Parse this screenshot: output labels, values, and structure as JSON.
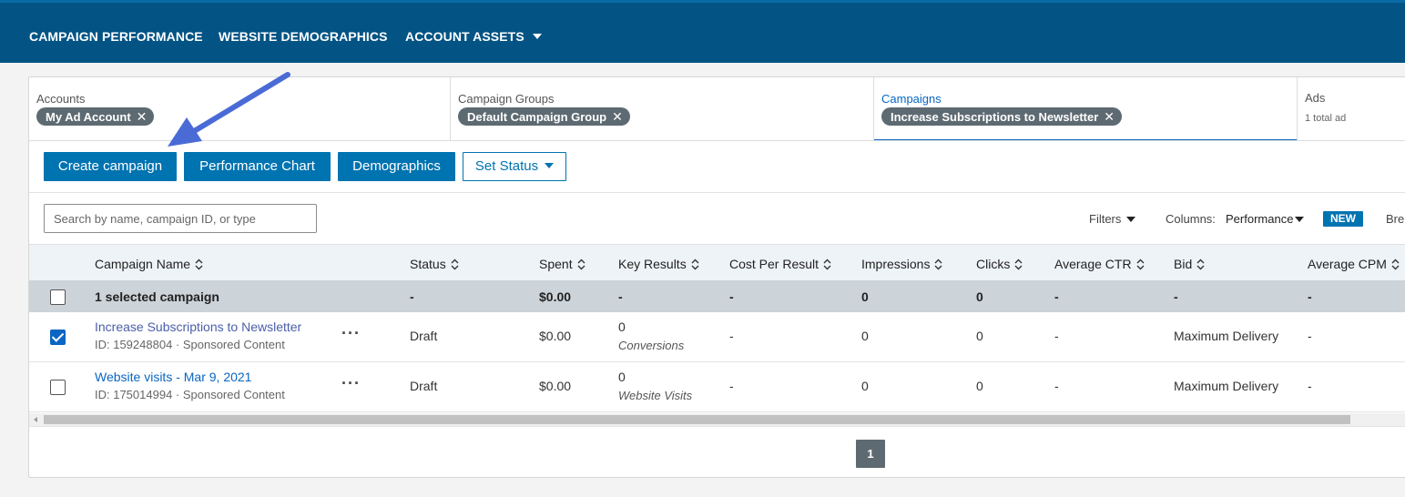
{
  "topnav": {
    "campaign_performance": "CAMPAIGN PERFORMANCE",
    "website_demographics": "WEBSITE DEMOGRAPHICS",
    "account_assets": "ACCOUNT ASSETS"
  },
  "breadcrumbs": {
    "accounts": {
      "title": "Accounts",
      "chip": "My Ad Account"
    },
    "campaign_groups": {
      "title": "Campaign Groups",
      "chip": "Default Campaign Group"
    },
    "campaigns": {
      "title": "Campaigns",
      "chip": "Increase Subscriptions to Newsletter"
    },
    "ads": {
      "title": "Ads",
      "sub": "1 total ad"
    }
  },
  "toolbar": {
    "create_campaign": "Create campaign",
    "performance_chart": "Performance Chart",
    "demographics": "Demographics",
    "set_status": "Set Status"
  },
  "search": {
    "placeholder": "Search by name, campaign ID, or type"
  },
  "controls": {
    "filters": "Filters",
    "columns_label": "Columns:",
    "columns_value": "Performance",
    "new_badge": "NEW",
    "breakdown_partial": "Bre"
  },
  "table": {
    "headers": [
      "Campaign Name",
      "Status",
      "Spent",
      "Key Results",
      "Cost Per Result",
      "Impressions",
      "Clicks",
      "Average CTR",
      "Bid",
      "Average CPM"
    ],
    "selected_row": {
      "label": "1 selected campaign",
      "status": "-",
      "spent": "$0.00",
      "key_results": "-",
      "cost_per_result": "-",
      "impressions": "0",
      "clicks": "0",
      "avg_ctr": "-",
      "bid": "-",
      "avg_cpm": "-"
    },
    "rows": [
      {
        "name": "Increase Subscriptions to Newsletter",
        "sub": "ID: 159248804 · Sponsored Content",
        "status": "Draft",
        "spent": "$0.00",
        "key_results_value": "0",
        "key_results_type": "Conversions",
        "cost_per_result": "-",
        "impressions": "0",
        "clicks": "0",
        "avg_ctr": "-",
        "bid": "Maximum Delivery",
        "avg_cpm": "-",
        "checked": true
      },
      {
        "name": "Website visits - Mar 9, 2021",
        "sub": "ID: 175014994 · Sponsored Content",
        "status": "Draft",
        "spent": "$0.00",
        "key_results_value": "0",
        "key_results_type": "Website Visits",
        "cost_per_result": "-",
        "impressions": "0",
        "clicks": "0",
        "avg_ctr": "-",
        "bid": "Maximum Delivery",
        "avg_cpm": "-",
        "checked": false
      }
    ]
  },
  "pagination": {
    "current": "1"
  },
  "colors": {
    "nav_bg": "#035485",
    "primary": "#0073b1",
    "chip_bg": "#5e6a72",
    "annotation_arrow": "#4a6bd6"
  }
}
